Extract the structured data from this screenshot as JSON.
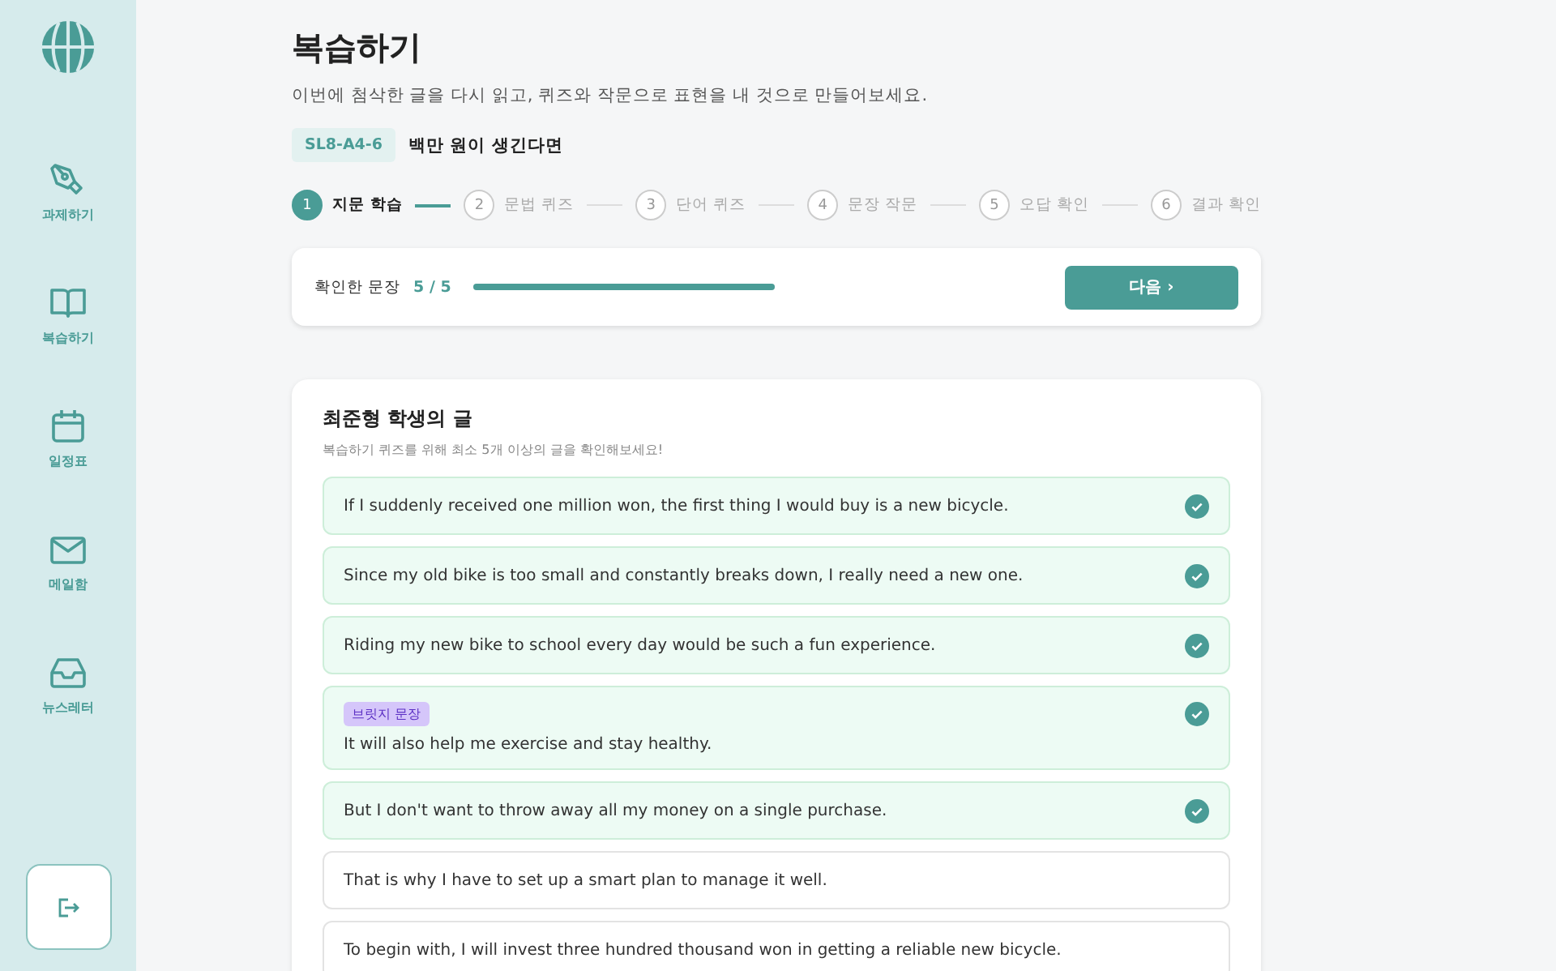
{
  "sidebar": {
    "items": [
      {
        "kind": "pen",
        "label": "과제하기"
      },
      {
        "kind": "book",
        "label": "복습하기"
      },
      {
        "kind": "calendar",
        "label": "일정표"
      },
      {
        "kind": "mail",
        "label": "메일함"
      },
      {
        "kind": "inbox",
        "label": "뉴스레터"
      }
    ]
  },
  "header": {
    "title": "복습하기",
    "subtitle": "이번에 첨삭한 글을 다시 읽고, 퀴즈와 작문으로 표현을 내 것으로 만들어보세요.",
    "code": "SL8-A4-6",
    "topic": "백만 원이 생긴다면"
  },
  "steps": [
    {
      "number": "1",
      "label": "지문 학습",
      "selected": true
    },
    {
      "number": "2",
      "label": "문법 퀴즈",
      "selected": false
    },
    {
      "number": "3",
      "label": "단어 퀴즈",
      "selected": false
    },
    {
      "number": "4",
      "label": "문장 작문",
      "selected": false
    },
    {
      "number": "5",
      "label": "오답 확인",
      "selected": false
    },
    {
      "number": "6",
      "label": "결과 확인",
      "selected": false
    }
  ],
  "progress": {
    "label": "확인한 문장",
    "count": "5 / 5",
    "level": 1,
    "button": "다음 ›"
  },
  "sentences_card": {
    "title": "최준형 학생의 글",
    "subtitle": "복습하기 퀴즈를 위해 최소 5개 이상의 글을 확인해보세요!",
    "sentences": [
      {
        "text": "If I suddenly received one million won, the first thing I would buy is a new bicycle.",
        "checked": true
      },
      {
        "text": "Since my old bike is too small and constantly breaks down, I really need a new one.",
        "checked": true
      },
      {
        "text": "Riding my new bike to school every day would be such a fun experience.",
        "checked": true
      },
      {
        "text": "It will also help me exercise and stay healthy.",
        "tag": "브릿지 문장",
        "checked": true
      },
      {
        "text": "But I don't want to throw away all my money on a single purchase.",
        "checked": true
      },
      {
        "text": "That is why I have to set up a smart plan to manage it well.",
        "checked": false
      },
      {
        "text": "To begin with, I will invest three hundred thousand won in getting a reliable new bicycle.",
        "checked": false
      }
    ]
  }
}
